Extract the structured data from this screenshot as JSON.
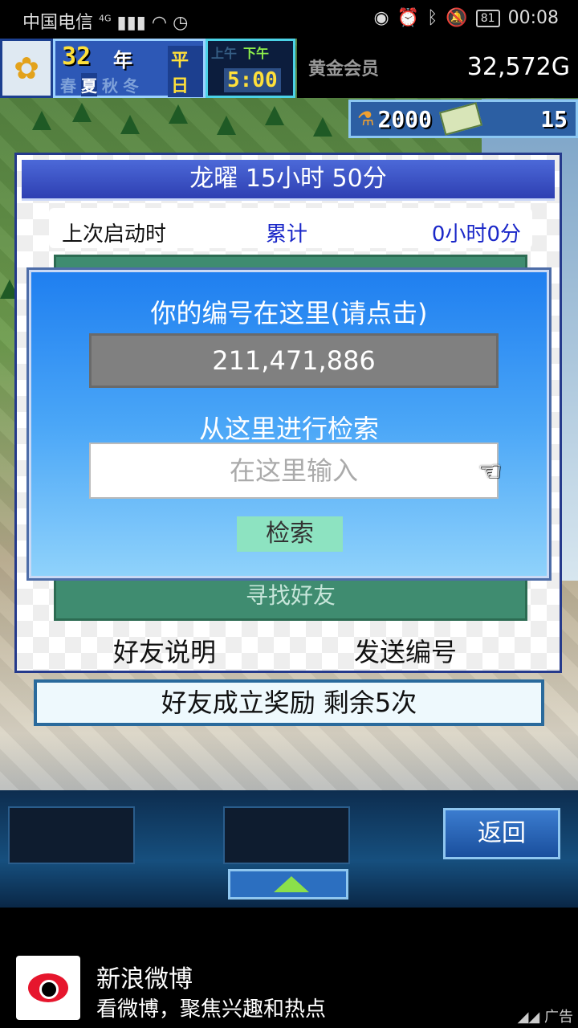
{
  "statusbar": {
    "carrier": "中国电信",
    "network": "4G",
    "battery": "81",
    "time": "00:08"
  },
  "hud": {
    "year": "32",
    "year_unit": "年",
    "weekday": "平日",
    "seasons": [
      "春",
      "夏",
      "秋",
      "冬"
    ],
    "active_season_index": 1,
    "am_label": "上午",
    "pm_label": "下午",
    "clock": "5:00",
    "member_label": "黄金会员",
    "money": "32,572G",
    "points": "2000",
    "tickets": "15",
    "icons": {
      "season_icon": "sunflower-icon",
      "points_icon": "flask-icon",
      "tickets_icon": "ticket-icon"
    }
  },
  "friend_panel": {
    "title": "龙曜  15小时 50分",
    "last_launch_label": "上次启动时",
    "total_label": "累计",
    "total_value": "0小时0分",
    "find_friend": "寻找好友",
    "friend_help": "好友说明",
    "send_code": "发送编号",
    "reward": "好友成立奖励  剩余5次"
  },
  "dialog": {
    "title": "你的编号在这里(请点击)",
    "id_number": "211,471,886",
    "search_label": "从这里进行检索",
    "search_placeholder": "在这里输入",
    "search_button": "检索"
  },
  "bottom": {
    "back_label": "返回"
  },
  "ad": {
    "title": "新浪微博",
    "subtitle": "看微博，聚焦兴趣和热点",
    "tag": "广告"
  }
}
